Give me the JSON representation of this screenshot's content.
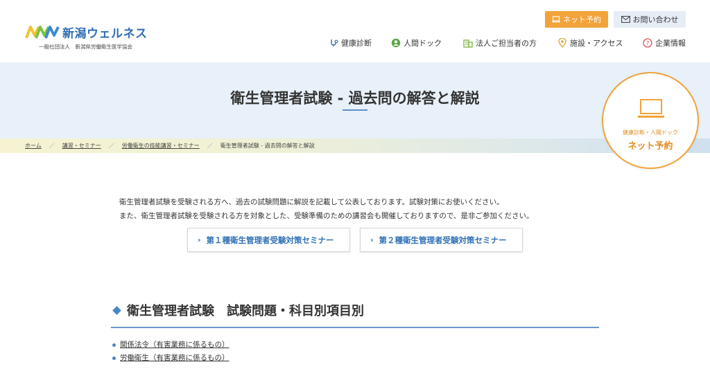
{
  "brand": {
    "name": "新潟ウェルネス",
    "sub": "一般社団法人　新潟県労働衛生医学協会"
  },
  "header": {
    "net_reserve": "ネット予約",
    "contact": "お問い合わせ"
  },
  "gnav": [
    {
      "label": "健康診断",
      "icon": "stethoscope-icon"
    },
    {
      "label": "人間ドック",
      "icon": "person-circle-icon"
    },
    {
      "label": "法人ご担当者の方",
      "icon": "building-icon"
    },
    {
      "label": "施設・アクセス",
      "icon": "map-pin-icon"
    },
    {
      "label": "企業情報",
      "icon": "question-circle-icon"
    }
  ],
  "hero": {
    "title": "衛生管理者試験 - 過去問の解答と解説"
  },
  "breadcrumb": [
    "ホーム",
    "講習・セミナー",
    "労働衛生の技能講習・セミナー",
    "衛生管理者試験 - 過去問の解答と解説"
  ],
  "reserve_circle": {
    "sub": "健康診断・人間ドック",
    "main": "ネット予約"
  },
  "intro": {
    "line1": "衛生管理者試験を受験される方へ、過去の試験問題に解説を記載して公表しております。試験対策にお使いください。",
    "line2": "また、衛生管理者試験を受験される方を対象とした、受験準備のための講習会も開催しておりますので、是非ご参加ください。"
  },
  "seminar_buttons": [
    "第１種衛生管理者受験対策セミナー",
    "第２種衛生管理者受験対策セミナー"
  ],
  "section": {
    "title": "衛生管理者試験　試験問題・科目別項目別",
    "links": [
      "関係法令（有害業務に係るもの）",
      "労働衛生（有害業務に係るもの）"
    ]
  },
  "colors": {
    "brand_blue": "#2f6fb5",
    "accent_orange": "#f2a33a",
    "hero_bg": "#e8f1f9"
  }
}
